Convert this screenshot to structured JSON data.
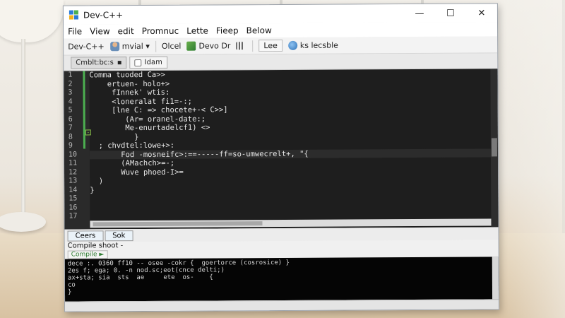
{
  "window": {
    "title": "Dev-C++",
    "controls": {
      "minimize": "—",
      "maximize": "☐",
      "close": "✕"
    }
  },
  "menu": [
    "File",
    "View",
    "edit",
    "Promnuc",
    "Lette",
    "Fieep",
    "Below"
  ],
  "toolbar": {
    "items": [
      "Dev-C++",
      "mvial ▾",
      "Olcel",
      "Devo Dr",
      "Lee",
      "ks lecsble"
    ]
  },
  "tabs": [
    {
      "label": "Cmblt:bc:s",
      "active": true
    },
    {
      "label": "Idam",
      "active": false
    }
  ],
  "editor": {
    "line_numbers": [
      "1",
      "2",
      "3",
      "4",
      "5",
      "6",
      "7",
      "8",
      "9",
      "10",
      "11",
      "12",
      "13",
      "14",
      "15",
      "16",
      "17"
    ],
    "lines": [
      "Comma tuoded Ca>>",
      "    ertuen- holo+>",
      "     fInnek' wtis:",
      "     <loneralat fi1=-:;",
      "     [lne C: => chocete+-< C>>]",
      "        (Ar= oranel-date:;",
      "        Me-enurtadelcf1) <>",
      "          }",
      "  ; chvdtel:lowe+>:",
      "       Fod -mosneifc>:==-----ff=so-umwecrelt+, \"{",
      "       (AMachch>=-;",
      "       Wuve phoed-I>=",
      "  )",
      "}",
      "",
      "",
      ""
    ]
  },
  "bottom_tabs": [
    "Ceers",
    "Sok"
  ],
  "compile": {
    "label": "Compile shoot  -",
    "subtab": "Compile  ►",
    "output": [
      "dece :. 0360 ff10 -- osee -cokr {  goertorce (cosrosice) }",
      "2es f; ega; 0. -n nod.sc;eot(cnce delti;)",
      "ax+sta; sia  sts  ae     ete  os-    {",
      "co",
      "}"
    ]
  }
}
